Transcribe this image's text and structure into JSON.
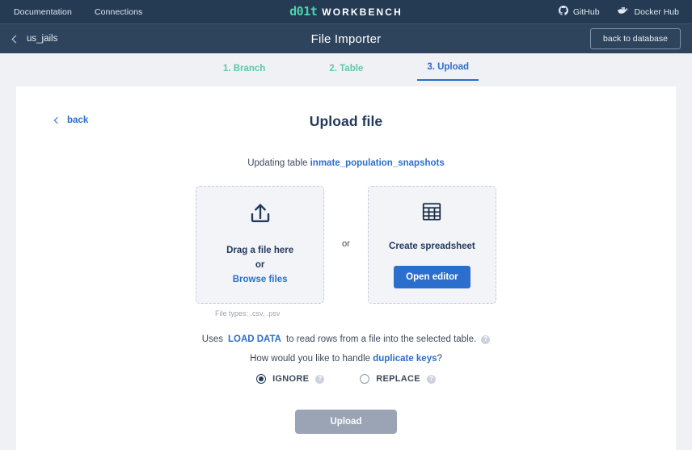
{
  "topnav": {
    "links": [
      {
        "label": "Documentation",
        "name": "nav-documentation"
      },
      {
        "label": "Connections",
        "name": "nav-connections"
      }
    ],
    "logo_mark": "d01t",
    "logo_word": "WORKBENCH",
    "external": [
      {
        "label": "GitHub",
        "icon": "github-icon"
      },
      {
        "label": "Docker Hub",
        "icon": "docker-icon"
      }
    ],
    "colors": {
      "bg": "#243b53",
      "logo_accent": "#4dd4ac"
    }
  },
  "subheader": {
    "back_icon": "chevron-left-icon",
    "database": "us_jails",
    "title": "File Importer",
    "back_to_database": "back to database",
    "bg": "#2e445c"
  },
  "steps": {
    "items": [
      {
        "label": "1. Branch",
        "active": false
      },
      {
        "label": "2. Table",
        "active": false
      },
      {
        "label": "3. Upload",
        "active": true
      }
    ],
    "active_color": "#2c6ecb",
    "inactive_color": "#5cc9a7"
  },
  "main": {
    "back_label": "back",
    "heading": "Upload file",
    "updating_prefix": "Updating table",
    "updating_table": "inmate_population_snapshots",
    "drop_box": {
      "icon": "upload-icon",
      "line1": "Drag a file here",
      "line2": "or",
      "browse_link": "Browse files"
    },
    "separator": "or",
    "spreadsheet_box": {
      "icon": "spreadsheet-icon",
      "title": "Create spreadsheet",
      "button": "Open editor"
    },
    "file_types": "File types: .csv, .psv",
    "info": {
      "prefix": "Uses",
      "command": "LOAD DATA",
      "suffix": "to read rows from a file into the selected table.",
      "help_icon": "help-icon"
    },
    "duplicate": {
      "prefix": "How would you like to handle",
      "link": "duplicate keys",
      "suffix": "?"
    },
    "radios": [
      {
        "label": "IGNORE",
        "selected": true,
        "help_icon": "help-icon"
      },
      {
        "label": "REPLACE",
        "selected": false,
        "help_icon": "help-icon"
      }
    ],
    "upload_button": "Upload"
  }
}
